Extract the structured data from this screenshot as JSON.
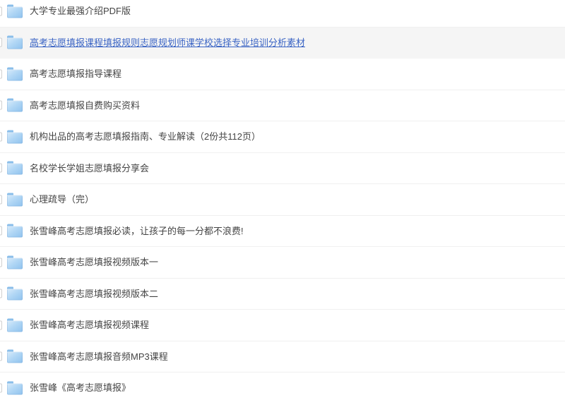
{
  "list": {
    "active_index": 1,
    "items": [
      {
        "label": "大学专业最强介绍PDF版"
      },
      {
        "label": "高考志愿填报课程填报规则志愿规划师课学校选择专业培训分析素材"
      },
      {
        "label": "高考志愿填报指导课程"
      },
      {
        "label": "高考志愿填报自费购买资料"
      },
      {
        "label": "机构出品的高考志愿填报指南、专业解读（2份共112页）"
      },
      {
        "label": "名校学长学姐志愿填报分享会"
      },
      {
        "label": "心理疏导（完）"
      },
      {
        "label": "张雪峰高考志愿填报必读，让孩子的每一分都不浪费!"
      },
      {
        "label": "张雪峰高考志愿填报视频版本一"
      },
      {
        "label": "张雪峰高考志愿填报视频版本二"
      },
      {
        "label": "张雪峰高考志愿填报视频课程"
      },
      {
        "label": "张雪峰高考志愿填报音频MP3课程"
      },
      {
        "label": "张雪峰《高考志愿填报》"
      }
    ]
  },
  "icons": {
    "folder": "folder-icon (css light-blue folder shape)",
    "checkbox": "checkbox-icon (css empty square, clipped at left edge)"
  },
  "colors": {
    "link_blue": "#3a64c4",
    "text_gray": "#444444",
    "row_highlight_bg": "#f5f5f5",
    "divider": "#f0f0f0",
    "folder_blue": "#8fc2ee",
    "folder_tab": "#8abeea",
    "checkbox_border": "#d0d0d0"
  }
}
